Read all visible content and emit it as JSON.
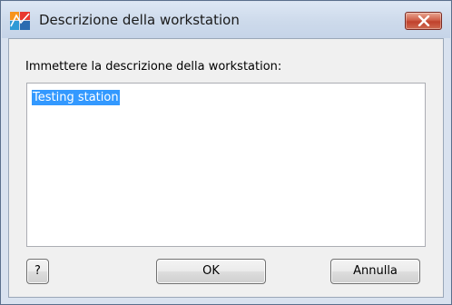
{
  "window": {
    "title": "Descrizione della workstation",
    "close_icon": "close-icon"
  },
  "form": {
    "prompt_label": "Immettere la descrizione della workstation:",
    "description_value": "Testing station"
  },
  "buttons": {
    "help_label": "?",
    "ok_label": "OK",
    "cancel_label": "Annulla"
  },
  "colors": {
    "selection": "#3399ff",
    "close_button": "#c0412c",
    "titlebar": "#cddaeb"
  }
}
